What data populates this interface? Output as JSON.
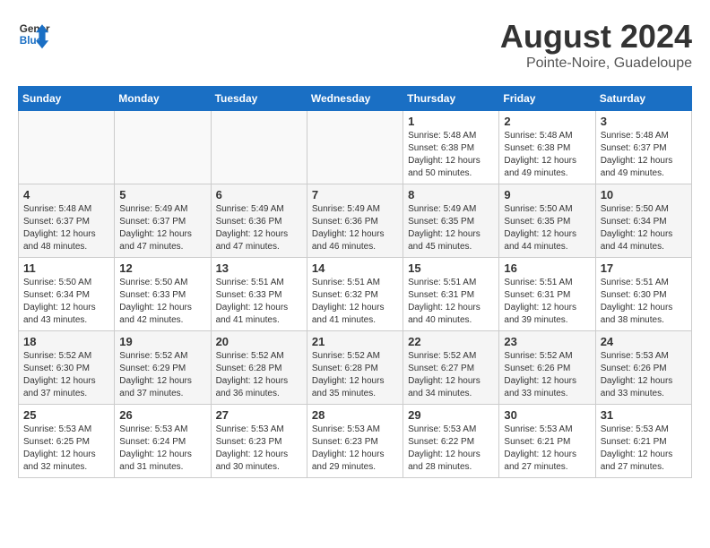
{
  "header": {
    "logo_general": "General",
    "logo_blue": "Blue",
    "month_title": "August 2024",
    "subtitle": "Pointe-Noire, Guadeloupe"
  },
  "days_of_week": [
    "Sunday",
    "Monday",
    "Tuesday",
    "Wednesday",
    "Thursday",
    "Friday",
    "Saturday"
  ],
  "weeks": [
    [
      {
        "day": "",
        "info": ""
      },
      {
        "day": "",
        "info": ""
      },
      {
        "day": "",
        "info": ""
      },
      {
        "day": "",
        "info": ""
      },
      {
        "day": "1",
        "info": "Sunrise: 5:48 AM\nSunset: 6:38 PM\nDaylight: 12 hours\nand 50 minutes."
      },
      {
        "day": "2",
        "info": "Sunrise: 5:48 AM\nSunset: 6:38 PM\nDaylight: 12 hours\nand 49 minutes."
      },
      {
        "day": "3",
        "info": "Sunrise: 5:48 AM\nSunset: 6:37 PM\nDaylight: 12 hours\nand 49 minutes."
      }
    ],
    [
      {
        "day": "4",
        "info": "Sunrise: 5:48 AM\nSunset: 6:37 PM\nDaylight: 12 hours\nand 48 minutes."
      },
      {
        "day": "5",
        "info": "Sunrise: 5:49 AM\nSunset: 6:37 PM\nDaylight: 12 hours\nand 47 minutes."
      },
      {
        "day": "6",
        "info": "Sunrise: 5:49 AM\nSunset: 6:36 PM\nDaylight: 12 hours\nand 47 minutes."
      },
      {
        "day": "7",
        "info": "Sunrise: 5:49 AM\nSunset: 6:36 PM\nDaylight: 12 hours\nand 46 minutes."
      },
      {
        "day": "8",
        "info": "Sunrise: 5:49 AM\nSunset: 6:35 PM\nDaylight: 12 hours\nand 45 minutes."
      },
      {
        "day": "9",
        "info": "Sunrise: 5:50 AM\nSunset: 6:35 PM\nDaylight: 12 hours\nand 44 minutes."
      },
      {
        "day": "10",
        "info": "Sunrise: 5:50 AM\nSunset: 6:34 PM\nDaylight: 12 hours\nand 44 minutes."
      }
    ],
    [
      {
        "day": "11",
        "info": "Sunrise: 5:50 AM\nSunset: 6:34 PM\nDaylight: 12 hours\nand 43 minutes."
      },
      {
        "day": "12",
        "info": "Sunrise: 5:50 AM\nSunset: 6:33 PM\nDaylight: 12 hours\nand 42 minutes."
      },
      {
        "day": "13",
        "info": "Sunrise: 5:51 AM\nSunset: 6:33 PM\nDaylight: 12 hours\nand 41 minutes."
      },
      {
        "day": "14",
        "info": "Sunrise: 5:51 AM\nSunset: 6:32 PM\nDaylight: 12 hours\nand 41 minutes."
      },
      {
        "day": "15",
        "info": "Sunrise: 5:51 AM\nSunset: 6:31 PM\nDaylight: 12 hours\nand 40 minutes."
      },
      {
        "day": "16",
        "info": "Sunrise: 5:51 AM\nSunset: 6:31 PM\nDaylight: 12 hours\nand 39 minutes."
      },
      {
        "day": "17",
        "info": "Sunrise: 5:51 AM\nSunset: 6:30 PM\nDaylight: 12 hours\nand 38 minutes."
      }
    ],
    [
      {
        "day": "18",
        "info": "Sunrise: 5:52 AM\nSunset: 6:30 PM\nDaylight: 12 hours\nand 37 minutes."
      },
      {
        "day": "19",
        "info": "Sunrise: 5:52 AM\nSunset: 6:29 PM\nDaylight: 12 hours\nand 37 minutes."
      },
      {
        "day": "20",
        "info": "Sunrise: 5:52 AM\nSunset: 6:28 PM\nDaylight: 12 hours\nand 36 minutes."
      },
      {
        "day": "21",
        "info": "Sunrise: 5:52 AM\nSunset: 6:28 PM\nDaylight: 12 hours\nand 35 minutes."
      },
      {
        "day": "22",
        "info": "Sunrise: 5:52 AM\nSunset: 6:27 PM\nDaylight: 12 hours\nand 34 minutes."
      },
      {
        "day": "23",
        "info": "Sunrise: 5:52 AM\nSunset: 6:26 PM\nDaylight: 12 hours\nand 33 minutes."
      },
      {
        "day": "24",
        "info": "Sunrise: 5:53 AM\nSunset: 6:26 PM\nDaylight: 12 hours\nand 33 minutes."
      }
    ],
    [
      {
        "day": "25",
        "info": "Sunrise: 5:53 AM\nSunset: 6:25 PM\nDaylight: 12 hours\nand 32 minutes."
      },
      {
        "day": "26",
        "info": "Sunrise: 5:53 AM\nSunset: 6:24 PM\nDaylight: 12 hours\nand 31 minutes."
      },
      {
        "day": "27",
        "info": "Sunrise: 5:53 AM\nSunset: 6:23 PM\nDaylight: 12 hours\nand 30 minutes."
      },
      {
        "day": "28",
        "info": "Sunrise: 5:53 AM\nSunset: 6:23 PM\nDaylight: 12 hours\nand 29 minutes."
      },
      {
        "day": "29",
        "info": "Sunrise: 5:53 AM\nSunset: 6:22 PM\nDaylight: 12 hours\nand 28 minutes."
      },
      {
        "day": "30",
        "info": "Sunrise: 5:53 AM\nSunset: 6:21 PM\nDaylight: 12 hours\nand 27 minutes."
      },
      {
        "day": "31",
        "info": "Sunrise: 5:53 AM\nSunset: 6:21 PM\nDaylight: 12 hours\nand 27 minutes."
      }
    ]
  ]
}
